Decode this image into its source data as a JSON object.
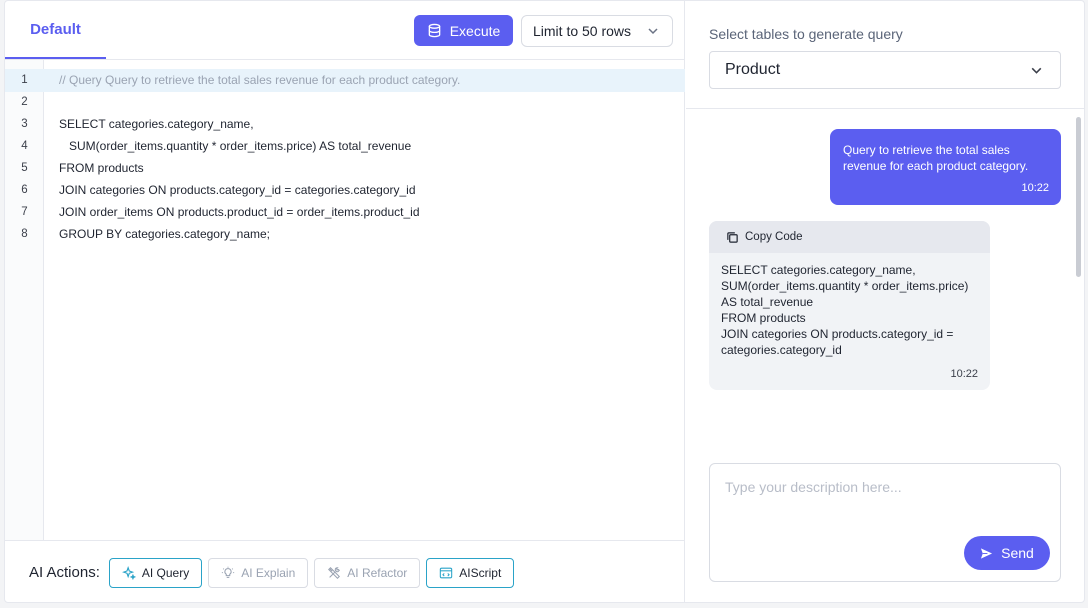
{
  "editor": {
    "tab_label": "Default",
    "execute_label": "Execute",
    "limit_select": "Limit to 50 rows",
    "lines": [
      {
        "num": "1",
        "text": "// Query Query to retrieve the total sales revenue for each product category."
      },
      {
        "num": "2",
        "text": ""
      },
      {
        "num": "3",
        "text": "SELECT categories.category_name,"
      },
      {
        "num": "4",
        "text": "   SUM(order_items.quantity * order_items.price) AS total_revenue"
      },
      {
        "num": "5",
        "text": "FROM products"
      },
      {
        "num": "6",
        "text": "JOIN categories ON products.category_id = categories.category_id"
      },
      {
        "num": "7",
        "text": "JOIN order_items ON products.product_id = order_items.product_id"
      },
      {
        "num": "8",
        "text": "GROUP BY categories.category_name;"
      }
    ]
  },
  "actions": {
    "label": "AI Actions:",
    "buttons": [
      {
        "label": "AI Query"
      },
      {
        "label": "AI Explain"
      },
      {
        "label": "AI Refactor"
      },
      {
        "label": "AIScript"
      }
    ]
  },
  "chat": {
    "select_label": "Select tables to generate query",
    "table_select": "Product",
    "user_message": {
      "line1": "Query to retrieve the total sales",
      "line2": "revenue for each product category.",
      "time": "10:22"
    },
    "bot_message": {
      "copy_label": "Copy Code",
      "lines": [
        "SELECT categories.category_name,",
        "SUM(order_items.quantity * order_items.price)",
        "AS total_revenue",
        "FROM products",
        "JOIN categories ON products.category_id =",
        "categories.category_id"
      ],
      "time": "10:22"
    },
    "input_placeholder": "Type your description here...",
    "send_label": "Send"
  },
  "colors": {
    "accent": "#5b5ef0",
    "active_border": "#2aa3c8",
    "line_highlight": "#e8f3fb"
  }
}
